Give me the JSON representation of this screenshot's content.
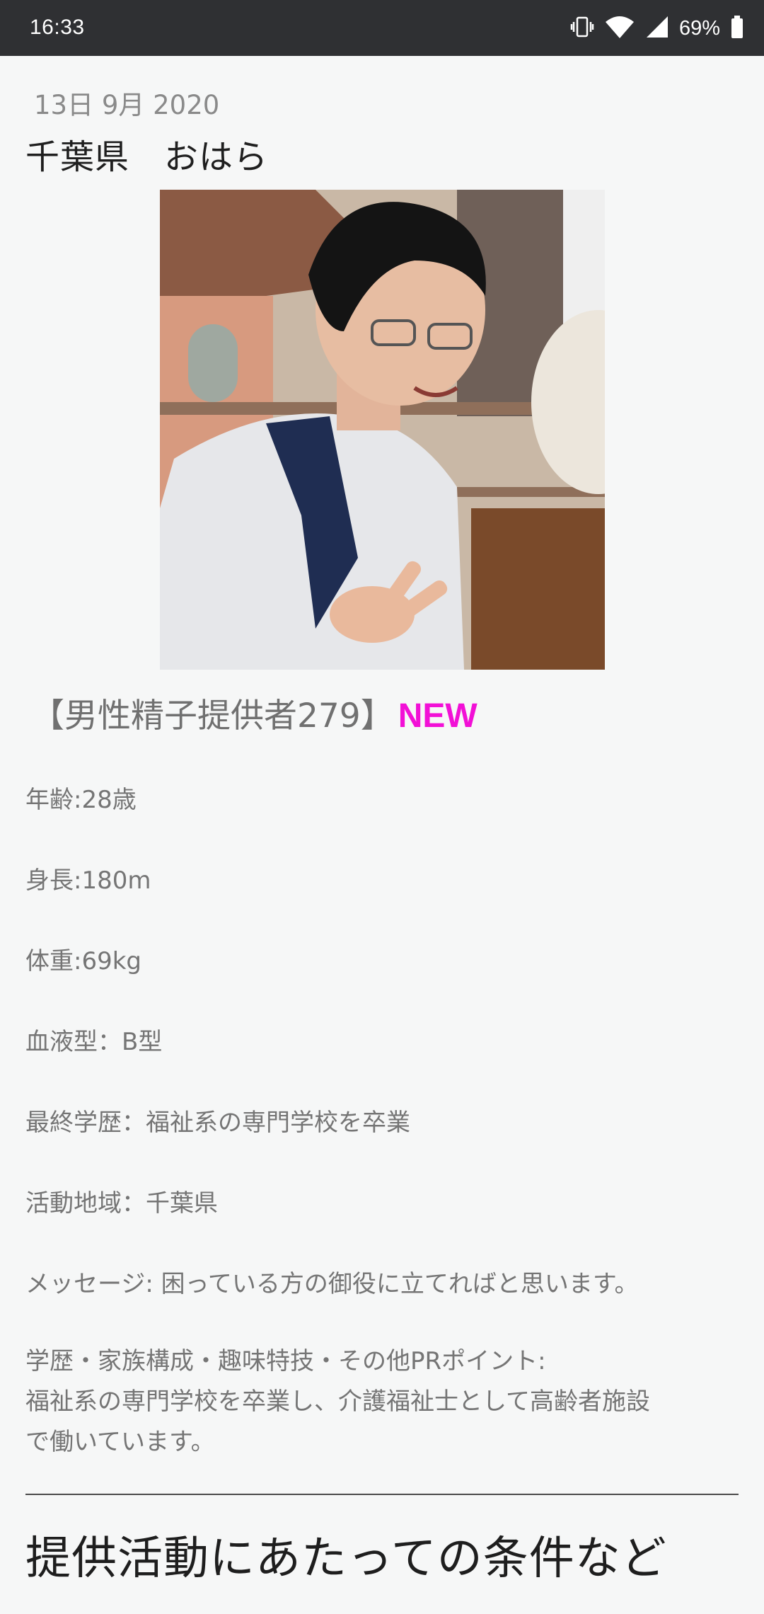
{
  "status_bar": {
    "time": "16:33",
    "battery_percent": "69%",
    "icons": [
      "vibrate-icon",
      "wifi-icon",
      "cell-signal-icon",
      "battery-icon"
    ]
  },
  "post": {
    "date": "13日 9月 2020",
    "location": "千葉県　おはら",
    "donor_heading": "【男性精子提供者279】",
    "new_badge": "NEW",
    "details": {
      "age": "年齢:28歳",
      "height": "身長:180m",
      "weight": "体重:69kg",
      "blood_type": "血液型：B型",
      "education": "最終学歴：福祉系の専門学校を卒業",
      "area": "活動地域：千葉県",
      "message": "メッセージ:  困っている方の御役に立てればと思います。"
    },
    "pr": {
      "label": "学歴・家族構成・趣味特技・その他PRポイント:",
      "text_line1": "福祉系の専門学校を卒業し、介護福祉士として高齢者施設",
      "text_line2": "で働いています。"
    },
    "section_title": "提供活動にあたっての条件など"
  },
  "colors": {
    "status_bar_bg": "#2f3033",
    "page_bg": "#f6f7f7",
    "new_badge": "#f210d6"
  }
}
